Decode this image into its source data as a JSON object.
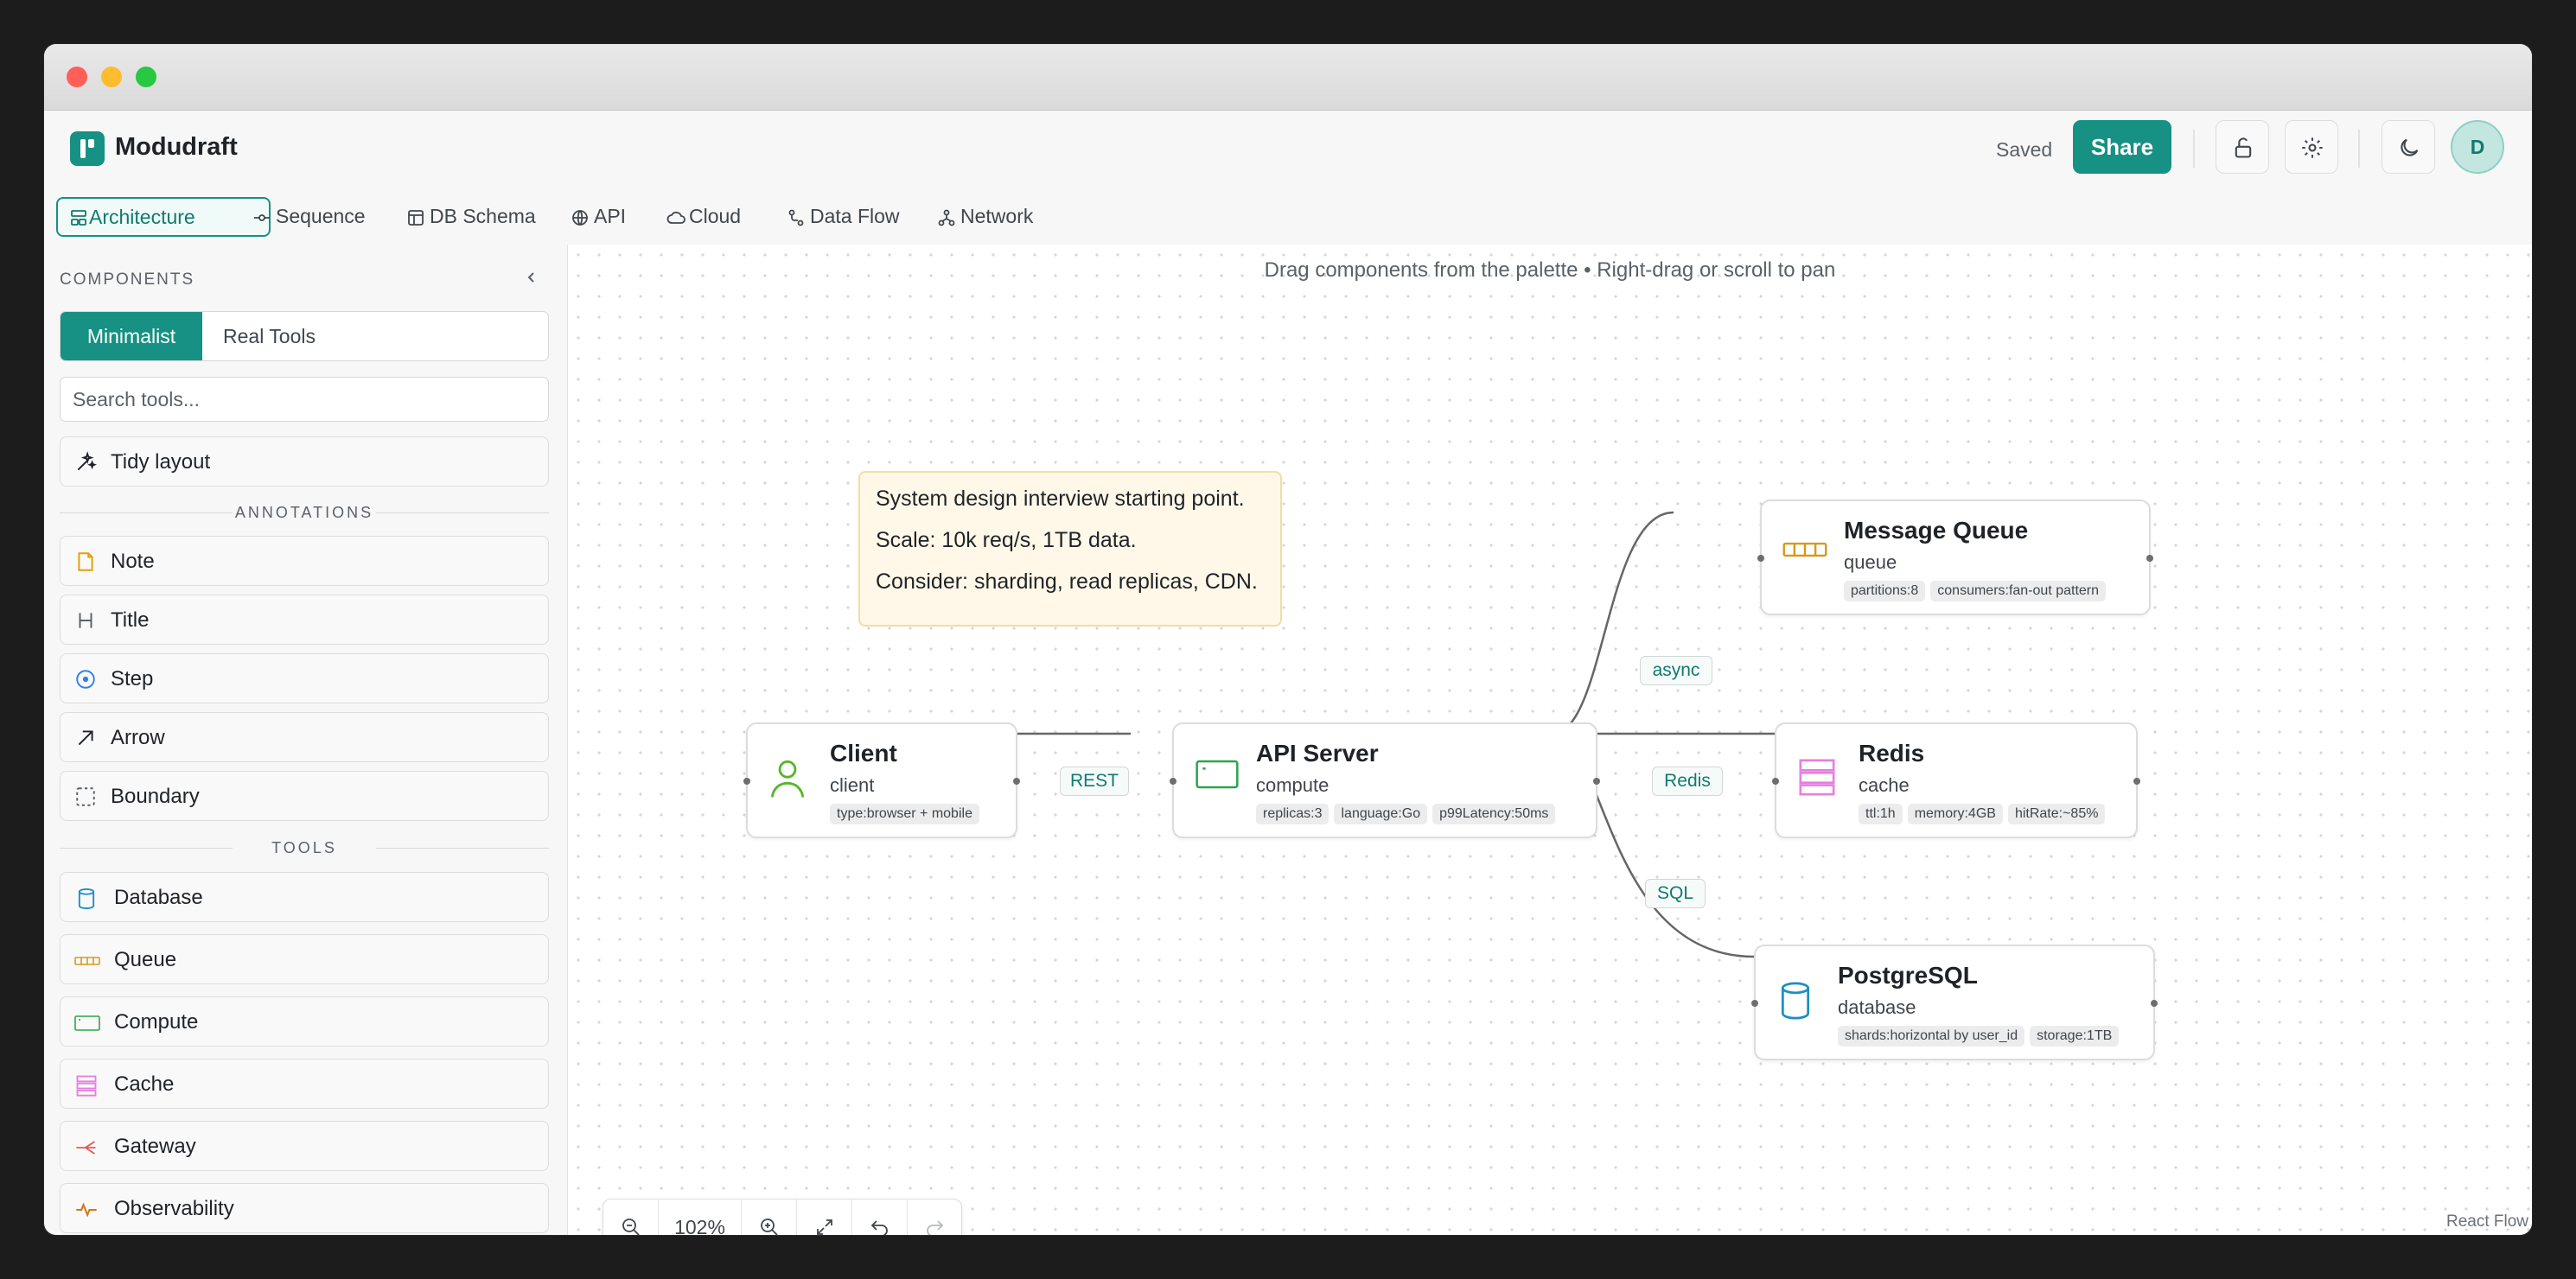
{
  "app": {
    "name": "Modudraft",
    "status": "Saved",
    "share_label": "Share",
    "avatar_initial": "D"
  },
  "tabs": [
    {
      "label": "Architecture",
      "icon": "architecture-icon",
      "active": true
    },
    {
      "label": "Sequence",
      "icon": "sequence-icon"
    },
    {
      "label": "DB Schema",
      "icon": "table-icon"
    },
    {
      "label": "API",
      "icon": "globe-icon"
    },
    {
      "label": "Cloud",
      "icon": "cloud-icon"
    },
    {
      "label": "Data Flow",
      "icon": "flow-icon"
    },
    {
      "label": "Network",
      "icon": "network-icon"
    }
  ],
  "sidebar": {
    "title": "COMPONENTS",
    "segments": [
      "Minimalist",
      "Real Tools"
    ],
    "search_placeholder": "Search tools...",
    "tidy_label": "Tidy layout",
    "annotations_title": "ANNOTATIONS",
    "annotations": [
      "Note",
      "Title",
      "Step",
      "Arrow",
      "Boundary"
    ],
    "tools_title": "TOOLS",
    "tools": [
      "Database",
      "Queue",
      "Compute",
      "Cache",
      "Gateway",
      "Observability"
    ]
  },
  "canvas": {
    "hint": "Drag components from the palette • Right-drag or scroll to pan",
    "note": [
      "System design interview starting point.",
      "Scale: 10k req/s, 1TB data.",
      "Consider: sharding, read replicas, CDN."
    ],
    "nodes": {
      "client": {
        "title": "Client",
        "type": "client",
        "tags": [
          "type:browser + mobile"
        ]
      },
      "api": {
        "title": "API Server",
        "type": "compute",
        "tags": [
          "replicas:3",
          "language:Go",
          "p99Latency:50ms"
        ]
      },
      "queue": {
        "title": "Message Queue",
        "type": "queue",
        "tags": [
          "partitions:8",
          "consumers:fan-out pattern"
        ]
      },
      "redis": {
        "title": "Redis",
        "type": "cache",
        "tags": [
          "ttl:1h",
          "memory:4GB",
          "hitRate:~85%"
        ]
      },
      "postgres": {
        "title": "PostgreSQL",
        "type": "database",
        "tags": [
          "shards:horizontal by user_id",
          "storage:1TB"
        ]
      }
    },
    "edges": {
      "rest": "REST",
      "async": "async",
      "redis": "Redis",
      "sql": "SQL"
    },
    "zoom": "102%",
    "attribution": "React Flow"
  },
  "colors": {
    "accent": "#179183",
    "note_bg": "#fff8e8"
  }
}
